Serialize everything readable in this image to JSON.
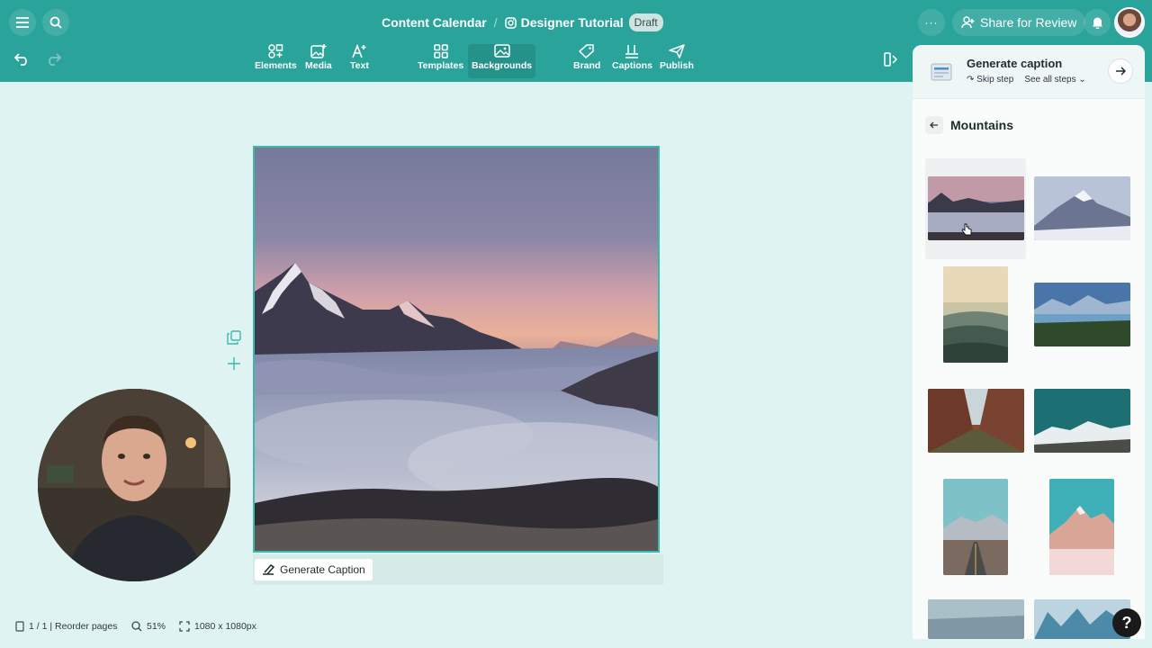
{
  "header": {
    "breadcrumb_parent": "Content Calendar",
    "breadcrumb_sep": "/",
    "breadcrumb_current": "Designer Tutorial",
    "status_badge": "Draft",
    "more_label": "···",
    "share_label": "Share for Review"
  },
  "toolbar": {
    "tools": [
      {
        "label": "Elements",
        "icon": "elements-icon"
      },
      {
        "label": "Media",
        "icon": "media-icon"
      },
      {
        "label": "Text",
        "icon": "text-icon"
      },
      {
        "label": "Templates",
        "icon": "templates-icon"
      },
      {
        "label": "Backgrounds",
        "icon": "backgrounds-icon",
        "active": true
      },
      {
        "label": "Brand",
        "icon": "brand-icon"
      },
      {
        "label": "Captions",
        "icon": "captions-icon"
      },
      {
        "label": "Publish",
        "icon": "publish-icon"
      }
    ]
  },
  "canvas": {
    "caption_button": "Generate Caption"
  },
  "status_bar": {
    "pages": "1 / 1 | Reorder pages",
    "zoom": "51%",
    "size": "1080 x 1080px"
  },
  "panel": {
    "step_title": "Generate caption",
    "skip_label": "Skip step",
    "see_all_label": "See all steps",
    "section_title": "Mountains"
  },
  "help_label": "?",
  "colors": {
    "brand": "#2aa39a",
    "canvas_bg": "#dff4f2",
    "accent_border": "#3bb9ad"
  }
}
